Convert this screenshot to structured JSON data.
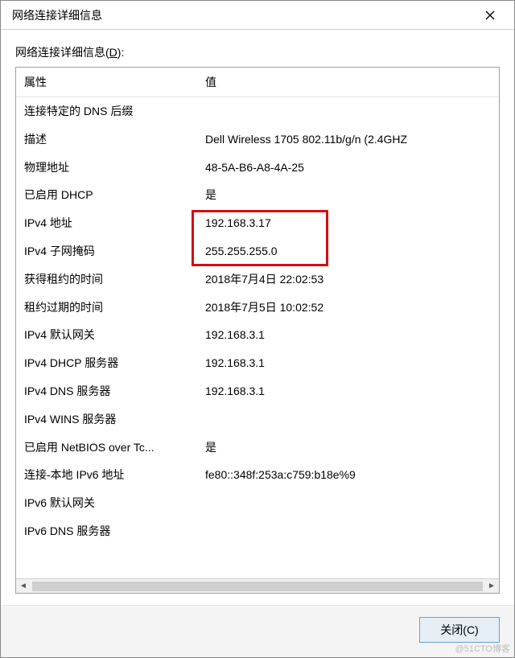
{
  "window": {
    "title": "网络连接详细信息"
  },
  "section": {
    "label_prefix": "网络连接详细信息(",
    "label_mnemonic": "D",
    "label_suffix": "):"
  },
  "columns": {
    "property": "属性",
    "value": "值"
  },
  "rows": [
    {
      "prop": "连接特定的 DNS 后缀",
      "val": ""
    },
    {
      "prop": "描述",
      "val": "Dell Wireless 1705 802.11b/g/n (2.4GHZ"
    },
    {
      "prop": "物理地址",
      "val": "48-5A-B6-A8-4A-25"
    },
    {
      "prop": "已启用 DHCP",
      "val": "是"
    },
    {
      "prop": "IPv4 地址",
      "val": "192.168.3.17"
    },
    {
      "prop": "IPv4 子网掩码",
      "val": "255.255.255.0"
    },
    {
      "prop": "获得租约的时间",
      "val": "2018年7月4日 22:02:53"
    },
    {
      "prop": "租约过期的时间",
      "val": "2018年7月5日 10:02:52"
    },
    {
      "prop": "IPv4 默认网关",
      "val": "192.168.3.1"
    },
    {
      "prop": "IPv4 DHCP 服务器",
      "val": "192.168.3.1"
    },
    {
      "prop": "IPv4 DNS 服务器",
      "val": "192.168.3.1"
    },
    {
      "prop": "IPv4 WINS 服务器",
      "val": ""
    },
    {
      "prop": "已启用 NetBIOS over Tc...",
      "val": "是"
    },
    {
      "prop": "连接-本地 IPv6 地址",
      "val": "fe80::348f:253a:c759:b18e%9"
    },
    {
      "prop": "IPv6 默认网关",
      "val": ""
    },
    {
      "prop": "IPv6 DNS 服务器",
      "val": ""
    }
  ],
  "buttons": {
    "close": "关闭(C)"
  },
  "watermark": "@51CTO博客"
}
